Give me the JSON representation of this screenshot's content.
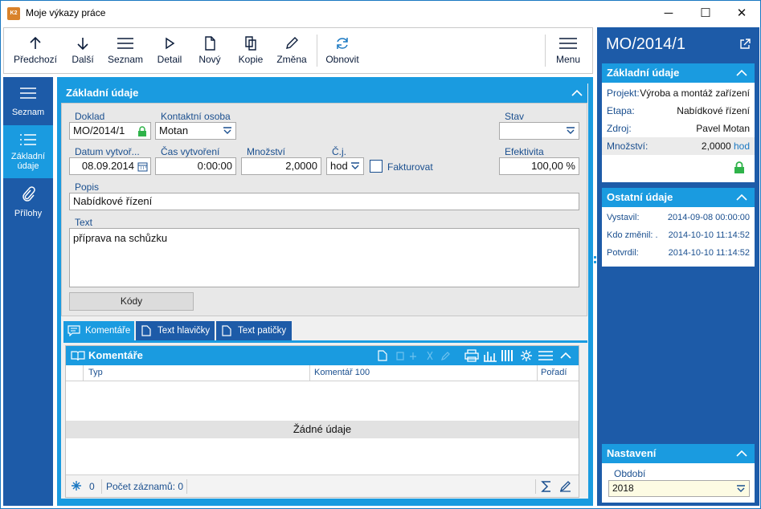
{
  "window": {
    "title": "Moje výkazy práce",
    "logo_text": "K2",
    "minimize": "─",
    "maximize": "☐",
    "close": "✕"
  },
  "toolbar": {
    "previous": "Předchozí",
    "next": "Další",
    "list": "Seznam",
    "detail": "Detail",
    "new": "Nový",
    "copy": "Kopie",
    "change": "Změna",
    "refresh": "Obnovit",
    "menu": "Menu"
  },
  "leftnav": {
    "list": "Seznam",
    "basic_line1": "Základní",
    "basic_line2": "údaje",
    "attachments": "Přílohy"
  },
  "basic": {
    "header": "Základní údaje",
    "doklad_label": "Doklad",
    "doklad_value": "MO/2014/1",
    "contact_label": "Kontaktní osoba",
    "contact_value": "Motan",
    "stav_label": "Stav",
    "stav_value": "",
    "date_label": "Datum vytvoř...",
    "date_value": "08.09.2014",
    "time_label": "Čas vytvoření",
    "time_value": "0:00:00",
    "qty_label": "Množství",
    "qty_value": "2,0000",
    "unit_label": "Č.j.",
    "unit_value": "hod",
    "invoice_label": "Fakturovat",
    "invoice_checked": false,
    "eff_label": "Efektivita",
    "eff_value": "100,00 %",
    "popis_label": "Popis",
    "popis_value": "Nabídkové řízení",
    "text_label": "Text",
    "text_value": "příprava na schůzku",
    "codes_button": "Kódy"
  },
  "tabs": [
    {
      "label": "Komentáře"
    },
    {
      "label": "Text hlavičky"
    },
    {
      "label": "Text patičky"
    }
  ],
  "comments": {
    "header": "Komentáře",
    "columns": [
      "Typ",
      "Komentář 100",
      "Pořadí"
    ],
    "empty_text": "Žádné údaje",
    "filter_count": "0",
    "record_count": "Počet záznamů: 0"
  },
  "right": {
    "title": "MO/2014/1",
    "basic_header": "Základní údaje",
    "project_label": "Projekt:",
    "project_value": "Výroba a montáž zařízení",
    "stage_label": "Etapa:",
    "stage_value": "Nabídkové řízení",
    "source_label": "Zdroj:",
    "source_value": "Pavel Motan",
    "qty_label": "Množství:",
    "qty_value": "2,0000",
    "qty_unit": "hod",
    "other_header": "Ostatní údaje",
    "issued_label": "Vystavil:",
    "issued_value": "2014-09-08 00:00:00",
    "changed_label": "Kdo změnil: .",
    "changed_value": "2014-10-10 11:14:52",
    "confirmed_label": "Potvrdil:",
    "confirmed_value": "2014-10-10 11:14:52",
    "settings_header": "Nastavení",
    "period_label": "Období",
    "period_value": "2018"
  },
  "colors": {
    "accent": "#1a9be0",
    "dark_blue": "#1d5ba8",
    "lock_green": "#2fb34a"
  }
}
